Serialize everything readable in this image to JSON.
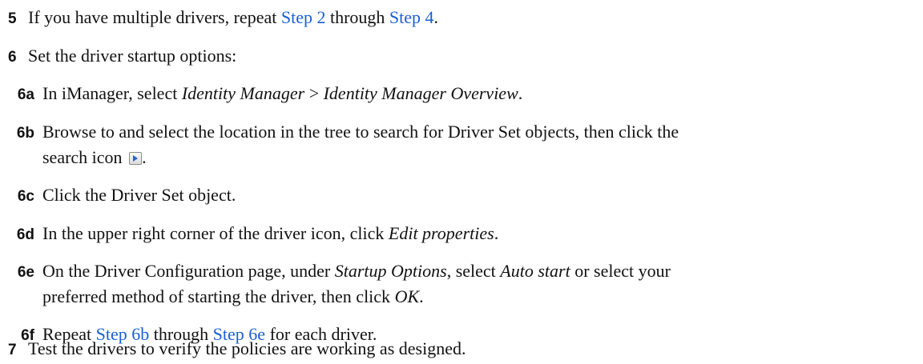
{
  "steps": {
    "s5": {
      "num": "5",
      "t1": "If you have multiple drivers, repeat ",
      "link1": "Step 2",
      "t2": " through ",
      "link2": "Step 4",
      "t3": "."
    },
    "s6": {
      "num": "6",
      "text": "Set the driver startup options:"
    },
    "s6a": {
      "num": "6a",
      "t1": "In iManager, select ",
      "em1": "Identity Manager",
      "t2": " > ",
      "em2": "Identity Manager Overview",
      "t3": "."
    },
    "s6b": {
      "num": "6b",
      "line1": "Browse to and select the location in the tree to search for Driver Set objects, then click the",
      "line2": "search icon ",
      "icon": "play-arrow-icon",
      "t3": "."
    },
    "s6c": {
      "num": "6c",
      "text": "Click the Driver Set object."
    },
    "s6d": {
      "num": "6d",
      "t1": "In the upper right corner of the driver icon, click ",
      "em1": "Edit properties",
      "t2": "."
    },
    "s6e": {
      "num": "6e",
      "t1": "On the Driver Configuration page, under ",
      "em1": "Startup Options",
      "t2": ", select ",
      "em2": "Auto start",
      "t3": " or select your",
      "line2a": "preferred method of starting the driver, then click ",
      "em3": "OK",
      "t4": "."
    },
    "s6f": {
      "num": "6f",
      "t1": "Repeat ",
      "link1": "Step 6b",
      "t2": " through ",
      "link2": "Step 6e",
      "t3": " for each driver."
    },
    "s7": {
      "num": "7",
      "text": "Test the drivers to verify the policies are working as designed."
    }
  },
  "colors": {
    "link": "#1a5fd6",
    "text": "#111111"
  }
}
